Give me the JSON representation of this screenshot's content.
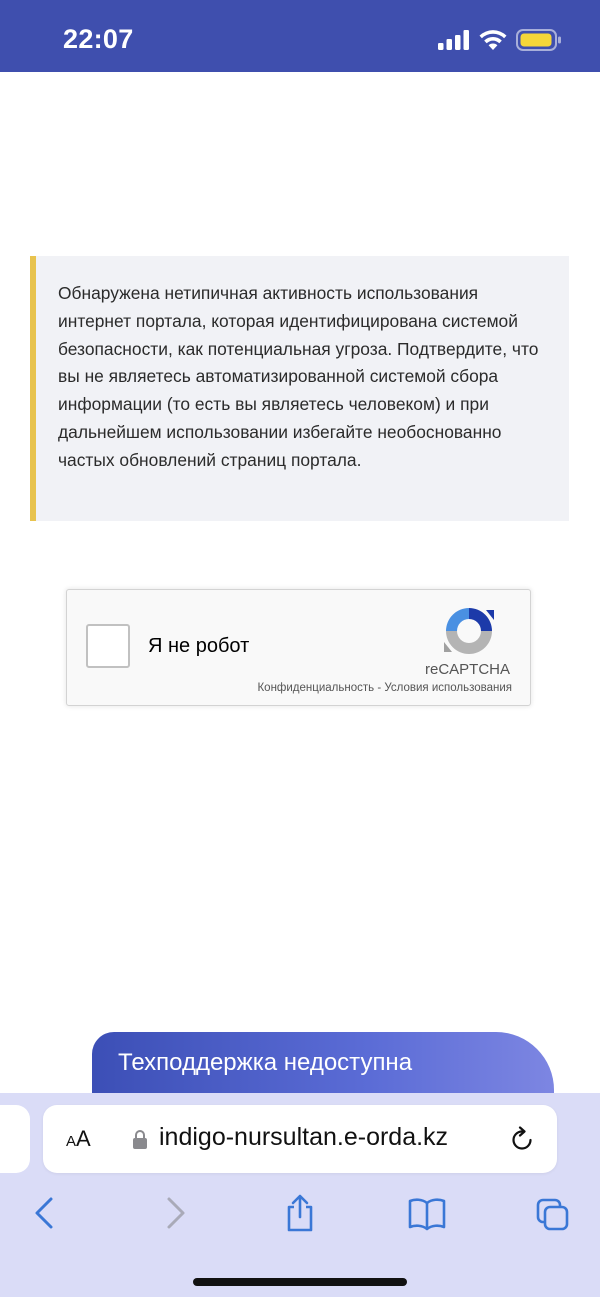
{
  "status_bar": {
    "time": "22:07",
    "icons": [
      "signal-icon",
      "wifi-icon",
      "battery-icon"
    ],
    "colors": {
      "background": "#3f4fae",
      "battery_fill": "#f5d63a"
    }
  },
  "notice": {
    "text": "Обнаружена нетипичная активность использования интернет портала, которая идентифицирована системой безопасности, как потенциальная угроза. Подтвердите, что вы не являетесь автоматизированной системой сбора информации (то есть вы являетесь человеком) и при дальнейшем использовании избегайте необоснованно частых обновлений страниц портала.",
    "accent_color": "#e8c34e"
  },
  "recaptcha": {
    "checkbox_label": "Я не робот",
    "checked": false,
    "brand": "reCAPTCHA",
    "privacy_link": "Конфиденциальность",
    "separator": " - ",
    "terms_link": "Условия использования",
    "icon": "recaptcha-logo-icon"
  },
  "support_banner": {
    "text": "Техподдержка недоступна"
  },
  "browser": {
    "text_size_label_small": "A",
    "text_size_label_large": "A",
    "url": "indigo-nursultan.e-orda.kz",
    "toolbar_icons": [
      "back-icon",
      "forward-icon",
      "share-icon",
      "bookmarks-icon",
      "tabs-icon"
    ],
    "accent_color": "#3a77d6"
  }
}
